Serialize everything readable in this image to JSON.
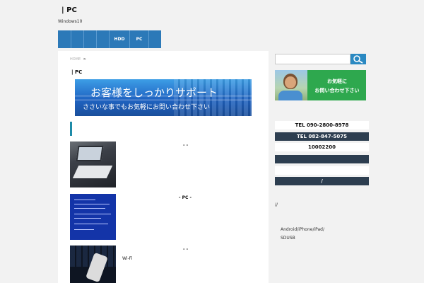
{
  "header": {
    "title": "| PC",
    "subtitle": "Windows10"
  },
  "nav": {
    "items": [
      "",
      "",
      "",
      "",
      "HDD",
      "PC",
      ""
    ]
  },
  "breadcrumb": {
    "home": "HOME",
    "sep": ">"
  },
  "main": {
    "page_title": "| PC",
    "banner": {
      "line1": "お客様をしっかりサポート",
      "line2": "ささいな事でもお気軽にお問い合わせ下さい"
    },
    "posts": [
      {
        "title": "-      -",
        "excerpt": "",
        "thumb": "laptop"
      },
      {
        "title": "- PC      -",
        "excerpt": "",
        "thumb": "bsod"
      },
      {
        "title": "-      -",
        "excerpt": "Wi-Fi",
        "thumb": "cable"
      }
    ]
  },
  "sidebar": {
    "search": {
      "placeholder": "",
      "icon": "search-icon"
    },
    "contact_banner": {
      "line1": "お気軽に",
      "line2": "お問い合わせ下さい"
    },
    "info": [
      "TEL 090-2800-8978",
      "TEL 082-847-5075",
      "10002200",
      "",
      "",
      "/"
    ],
    "text1": "//",
    "text2": "Android/iPhone/iPad/",
    "text3": "SDUSB"
  },
  "colors": {
    "nav": "#2c79b8",
    "accent": "#1e8ba8",
    "dark_bar": "#2d3e50",
    "contact_green": "#2ea84e"
  }
}
